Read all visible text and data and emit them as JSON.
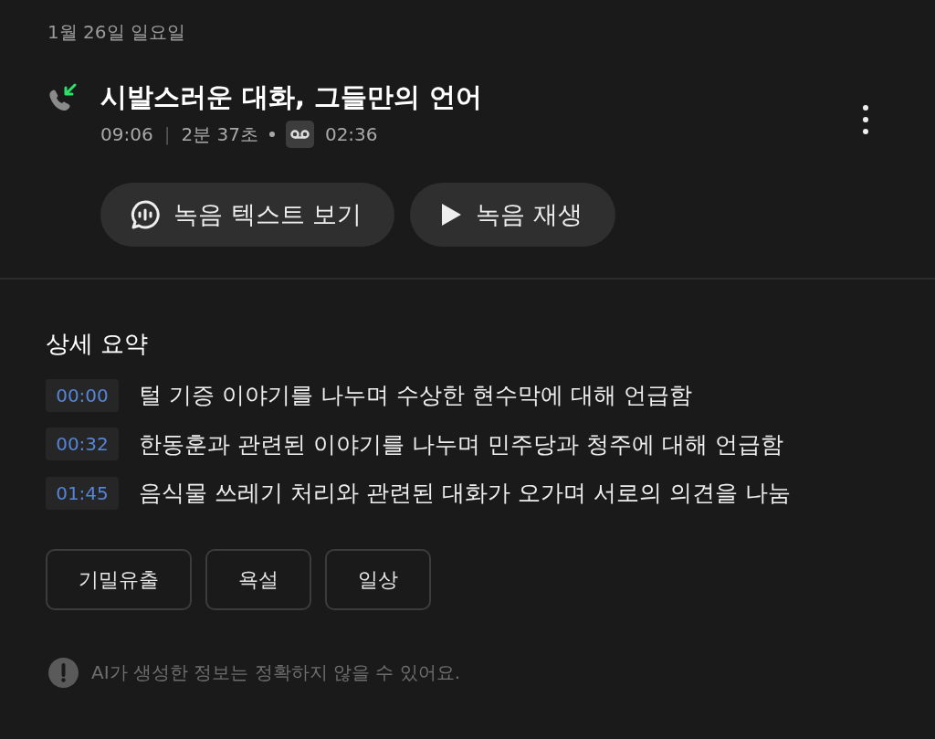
{
  "date": "1월 26일 일요일",
  "call": {
    "incoming": true,
    "title": "시발스러운 대화, 그들만의 언어",
    "time": "09:06",
    "separator": "|",
    "duration": "2분 37초",
    "recording_length": "02:36"
  },
  "actions": [
    {
      "kind": "transcript",
      "label": "녹음 텍스트 보기"
    },
    {
      "kind": "play",
      "label": "녹음 재생"
    }
  ],
  "summary": {
    "heading": "상세 요약",
    "items": [
      {
        "timestamp": "00:00",
        "text": "털 기증 이야기를 나누며 수상한 현수막에 대해 언급함"
      },
      {
        "timestamp": "00:32",
        "text": "한동훈과 관련된 이야기를 나누며 민주당과 청주에 대해 언급함"
      },
      {
        "timestamp": "01:45",
        "text": "음식물 쓰레기 처리와 관련된 대화가 오가며 서로의 의견을 나눔"
      }
    ],
    "tags": [
      "기밀유출",
      "욕설",
      "일상"
    ],
    "notice": "AI가 생성한 정보는 정확하지 않을 수 있어요."
  }
}
